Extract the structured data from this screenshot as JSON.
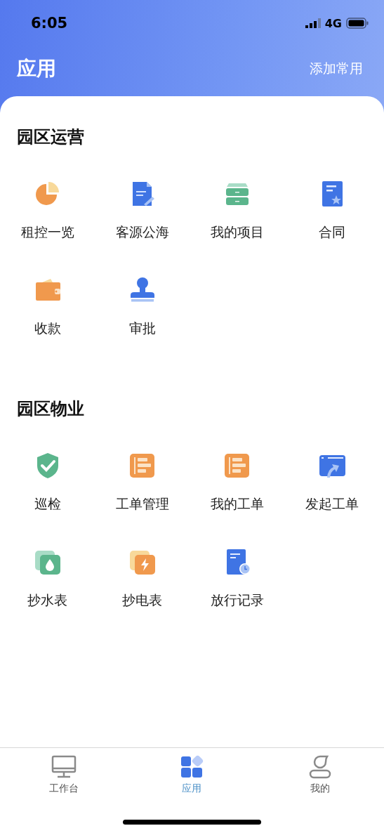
{
  "status_bar": {
    "time": "6:05",
    "network": "4G"
  },
  "header": {
    "title": "应用",
    "action": "添加常用"
  },
  "sections": [
    {
      "title": "园区运营",
      "items": [
        {
          "label": "租控一览",
          "kind": "pie"
        },
        {
          "label": "客源公海",
          "kind": "document"
        },
        {
          "label": "我的项目",
          "kind": "drawer"
        },
        {
          "label": "合同",
          "kind": "contract"
        },
        {
          "label": "收款",
          "kind": "wallet"
        },
        {
          "label": "审批",
          "kind": "stamp"
        }
      ]
    },
    {
      "title": "园区物业",
      "items": [
        {
          "label": "巡检",
          "kind": "shield"
        },
        {
          "label": "工单管理",
          "kind": "worksheet"
        },
        {
          "label": "我的工单",
          "kind": "worksheet"
        },
        {
          "label": "发起工单",
          "kind": "upload"
        },
        {
          "label": "抄水表",
          "kind": "water"
        },
        {
          "label": "抄电表",
          "kind": "electric"
        },
        {
          "label": "放行记录",
          "kind": "record"
        }
      ]
    }
  ],
  "tab_bar": [
    {
      "label": "工作台",
      "kind": "desktop",
      "selected": false
    },
    {
      "label": "应用",
      "kind": "apps",
      "selected": true
    },
    {
      "label": "我的",
      "kind": "person",
      "selected": false
    }
  ]
}
